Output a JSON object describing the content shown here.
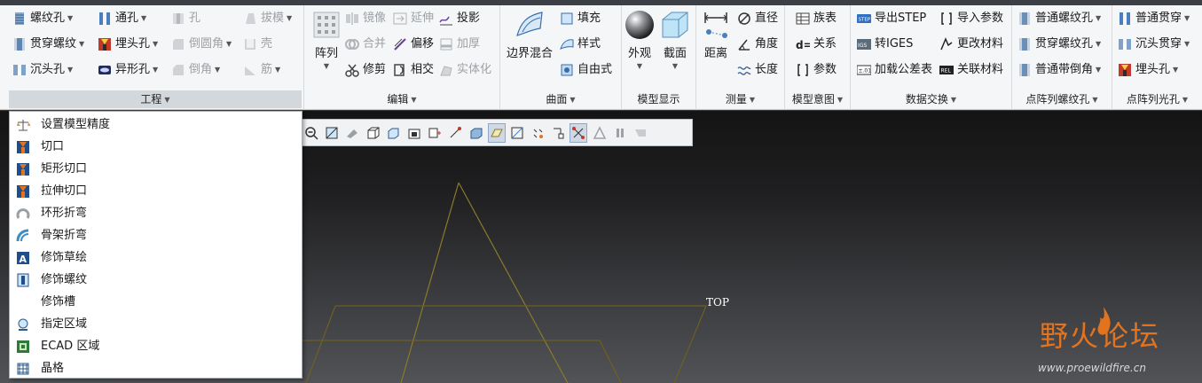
{
  "ribbon": {
    "engineering": {
      "label": "工程",
      "col1": [
        "螺纹孔",
        "贯穿螺纹",
        "沉头孔"
      ],
      "col2": [
        "通孔",
        "埋头孔",
        "异形孔"
      ],
      "col3": [
        "孔",
        "倒圆角",
        "倒角"
      ],
      "col4": [
        "拔模",
        "壳",
        "筋"
      ]
    },
    "edit": {
      "label": "编辑",
      "array": "阵列",
      "col1": [
        "镜像",
        "合并",
        "修剪"
      ],
      "col2": [
        "延伸",
        "偏移",
        "相交"
      ],
      "col3": [
        "投影",
        "加厚",
        "实体化"
      ]
    },
    "surface": {
      "label": "曲面",
      "boundary_blend": "边界混合",
      "items": [
        "填充",
        "样式",
        "自由式"
      ]
    },
    "model_display": {
      "label": "模型显示",
      "appearance": "外观",
      "section": "截面"
    },
    "measure": {
      "label": "测量",
      "distance": "距离",
      "items": [
        "直径",
        "角度",
        "长度"
      ]
    },
    "model_intent": {
      "label": "模型意图",
      "items": [
        "族表",
        "关系",
        "参数"
      ]
    },
    "data_exchange": {
      "label": "数据交换",
      "col1": [
        "导出STEP",
        "转IGES",
        "加载公差表"
      ],
      "col2": [
        "导入参数",
        "更改材料",
        "关联材料"
      ]
    },
    "point_array_thread": {
      "label": "点阵列螺纹孔",
      "items": [
        "普通螺纹孔",
        "贯穿螺纹孔",
        "普通带倒角"
      ]
    },
    "point_array_hole": {
      "label": "点阵列光孔",
      "items": [
        "普通贯穿",
        "沉头贯穿",
        "埋头孔"
      ]
    }
  },
  "menu": {
    "items": [
      "设置模型精度",
      "切口",
      "矩形切口",
      "拉伸切口",
      "环形折弯",
      "骨架折弯",
      "修饰草绘",
      "修饰螺纹",
      "修饰槽",
      "指定区域",
      "ECAD 区域",
      "晶格"
    ]
  },
  "viewport": {
    "datum_label": "TOP"
  },
  "watermark": {
    "title": "野火论坛",
    "url": "www.proewildfire.cn"
  },
  "colors": {
    "accent_orange": "#e2741f",
    "datum_line": "#8a7a2c",
    "ribbon_bg": "#f5f6f7"
  }
}
